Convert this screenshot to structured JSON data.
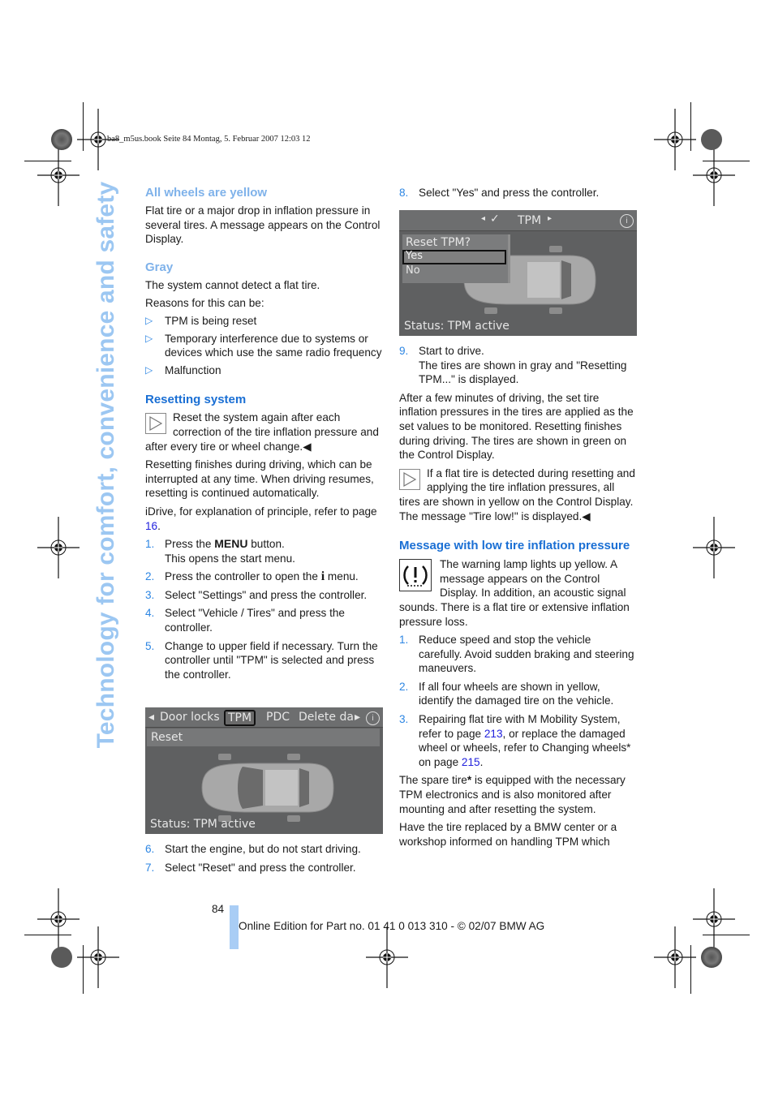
{
  "print_header": "ba8_m5us.book  Seite 84  Montag, 5. Februar 2007  12:03 12",
  "side_title": "Technology for comfort, convenience and safety",
  "left_column": {
    "all_wheels_heading": "All wheels are yellow",
    "all_wheels_text": "Flat tire or a major drop in inflation pressure in several tires. A message appears on the Control Display.",
    "gray_heading": "Gray",
    "gray_text": "The system cannot detect a flat tire.",
    "reasons_intro": "Reasons for this can be:",
    "reasons": [
      "TPM is being reset",
      "Temporary interference due to systems or devices which use the same radio frequency",
      "Malfunction"
    ],
    "resetting_heading": "Resetting system",
    "resetting_note": "Reset the system again after each correction of the tire inflation pressure and after every tire or wheel change.",
    "resetting_para": "Resetting finishes during driving, which can be interrupted at any time. When driving resumes, resetting is continued automatically.",
    "idrive_text": "iDrive, for explanation of principle, refer to page ",
    "idrive_page": "16",
    "steps": [
      {
        "n": "1.",
        "a": "Press the ",
        "b": "MENU",
        "c": " button.",
        "sub": "This opens the start menu."
      },
      {
        "n": "2.",
        "a": "Press the controller to open the ",
        "b": "i",
        "c": " menu."
      },
      {
        "n": "3.",
        "text": "Select \"Settings\" and press the controller."
      },
      {
        "n": "4.",
        "text": "Select \"Vehicle / Tires\" and press the controller."
      },
      {
        "n": "5.",
        "text": "Change to upper field if necessary. Turn the controller until \"TPM\" is selected and press the controller."
      }
    ],
    "screen1": {
      "tabs": [
        "Door locks",
        "TPM",
        "PDC",
        "Delete da"
      ],
      "selected_tab": "TPM",
      "menu_item": "Reset",
      "status": "Status: TPM active"
    },
    "steps2": [
      {
        "n": "6.",
        "text": "Start the engine, but do not start driving."
      },
      {
        "n": "7.",
        "text": "Select \"Reset\" and press the controller."
      }
    ]
  },
  "right_column": {
    "step8": {
      "n": "8.",
      "text": "Select \"Yes\" and press the controller."
    },
    "screen2": {
      "title": "TPM",
      "dialog_title": "Reset TPM?",
      "options": [
        "Yes",
        "No"
      ],
      "selected_option": "Yes",
      "status": "Status: TPM active"
    },
    "step9": {
      "n": "9.",
      "text": "Start to drive.",
      "sub": "The tires are shown in gray and \"Resetting TPM...\" is displayed."
    },
    "after_para": "After a few minutes of driving, the set tire inflation pressures in the tires are applied as the set values to be monitored. Resetting finishes during driving. The tires are shown in green on the Control Display.",
    "flat_note": "If a flat tire is detected during resetting and applying the tire inflation pressures, all tires are shown in yellow on the Control Display. The message \"Tire low!\" is displayed.",
    "low_heading": "Message with low tire inflation pressure",
    "low_para": "The warning lamp lights up yellow. A message appears on the Control Display. In addition, an acoustic signal sounds. There is a flat tire or extensive inflation pressure loss.",
    "low_steps": [
      {
        "n": "1.",
        "text": "Reduce speed and stop the vehicle carefully. Avoid sudden braking and steering maneuvers."
      },
      {
        "n": "2.",
        "text": "If all four wheels are shown in yellow, identify the damaged tire on the vehicle."
      },
      {
        "n": "3.",
        "a": "Repairing flat tire with M Mobility System, refer to page ",
        "p1": "213",
        "b": ", or replace the damaged wheel or wheels, refer to Changing wheels* on page ",
        "p2": "215",
        "c": "."
      }
    ],
    "spare_a": "The spare tire",
    "spare_star": "*",
    "spare_b": " is equipped with the necessary TPM electronics and is also monitored after mounting and after resetting the system.",
    "replace_para": "Have the tire replaced by a BMW center or a workshop informed on handling TPM which"
  },
  "footer": {
    "page_number": "84",
    "edition": "Online Edition for Part no. 01 41 0 013 310 - © 02/07 BMW AG"
  },
  "colors": {
    "heading_light": "#7fb2ea",
    "heading_blue": "#1a6fd4",
    "number_blue": "#2d86e3",
    "link_blue": "#2222dd",
    "side_title": "#9cc7f2",
    "footer_bar": "#a9cdf5"
  }
}
